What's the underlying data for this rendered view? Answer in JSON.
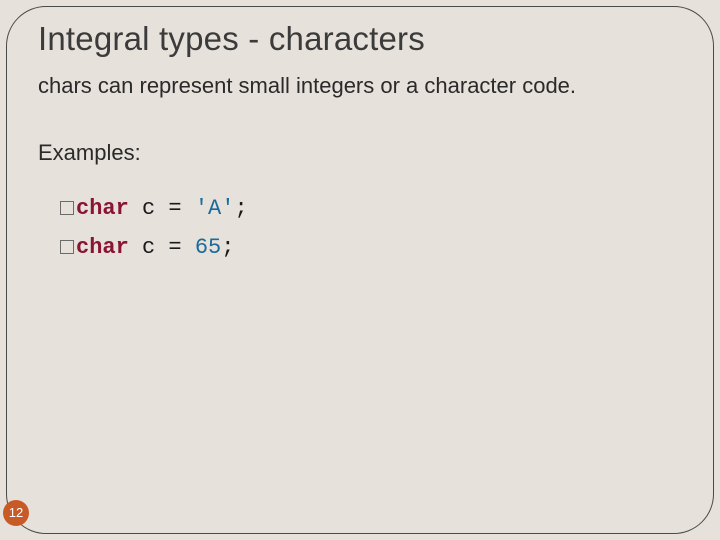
{
  "title": "Integral types - characters",
  "paragraph": "chars can represent small integers or a character code.",
  "examples_label": "Examples:",
  "code": {
    "line1": {
      "keyword": "char",
      "ident": " c ",
      "op": "= ",
      "literal": "'A'",
      "term": ";"
    },
    "line2": {
      "keyword": "char",
      "ident": " c ",
      "op": "= ",
      "literal": "65",
      "term": ";"
    }
  },
  "page_number": "12"
}
